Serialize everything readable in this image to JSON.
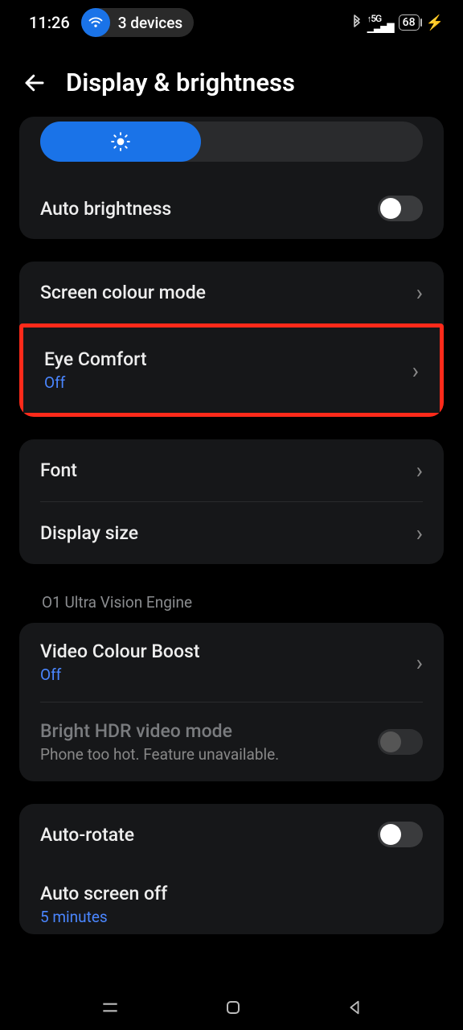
{
  "status": {
    "time": "11:26",
    "devices_label": "3 devices",
    "network_label": "5G",
    "battery_pct": "68"
  },
  "header": {
    "title": "Display & brightness"
  },
  "brightness": {
    "slider_pct": 42,
    "auto_label": "Auto brightness",
    "auto_on": false
  },
  "group_colour": {
    "items": [
      {
        "label": "Screen colour mode",
        "sub": null
      },
      {
        "label": "Eye Comfort",
        "sub": "Off",
        "highlighted": true
      }
    ]
  },
  "group_font": {
    "items": [
      {
        "label": "Font"
      },
      {
        "label": "Display size"
      }
    ]
  },
  "section_vision": {
    "header": "O1 Ultra Vision Engine",
    "video_boost": {
      "label": "Video Colour Boost",
      "sub": "Off"
    },
    "hdr": {
      "label": "Bright HDR video mode",
      "sub": "Phone too hot. Feature unavailable."
    }
  },
  "group_rotate": {
    "auto_rotate": {
      "label": "Auto-rotate",
      "on": false
    },
    "screen_off": {
      "label": "Auto screen off",
      "sub": "5 minutes"
    }
  }
}
